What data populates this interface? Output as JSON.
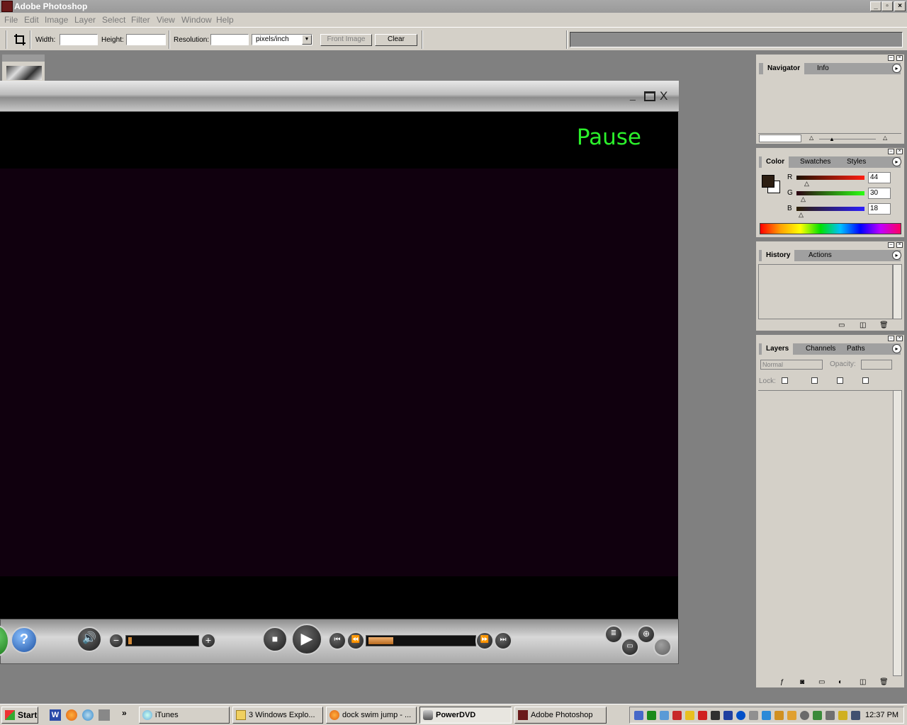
{
  "app": {
    "title": "Adobe Photoshop"
  },
  "menu": [
    "File",
    "Edit",
    "Image",
    "Layer",
    "Select",
    "Filter",
    "View",
    "Window",
    "Help"
  ],
  "options": {
    "width_label": "Width:",
    "height_label": "Height:",
    "resolution_label": "Resolution:",
    "unit_value": "pixels/inch",
    "front_image": "Front Image",
    "clear": "Clear"
  },
  "player": {
    "status_text": "Pause",
    "min": "_",
    "max": "□",
    "close": "X",
    "help": "?"
  },
  "palettes": {
    "navigator": {
      "tabs": [
        "Navigator",
        "Info"
      ]
    },
    "color": {
      "tabs": [
        "Color",
        "Swatches",
        "Styles"
      ],
      "r_label": "R",
      "g_label": "G",
      "b_label": "B",
      "r_value": "44",
      "g_value": "30",
      "b_value": "18",
      "foreground": "#2c1e12"
    },
    "history": {
      "tabs": [
        "History",
        "Actions"
      ]
    },
    "layers": {
      "tabs": [
        "Layers",
        "Channels",
        "Paths"
      ],
      "blend_mode": "Normal",
      "opacity_label": "Opacity:",
      "lock_label": "Lock:"
    }
  },
  "taskbar": {
    "start": "Start",
    "items": [
      "iTunes",
      "3 Windows Explo...",
      "dock swim jump - ...",
      "PowerDVD",
      "Adobe Photoshop"
    ],
    "clock": "12:37 PM"
  }
}
